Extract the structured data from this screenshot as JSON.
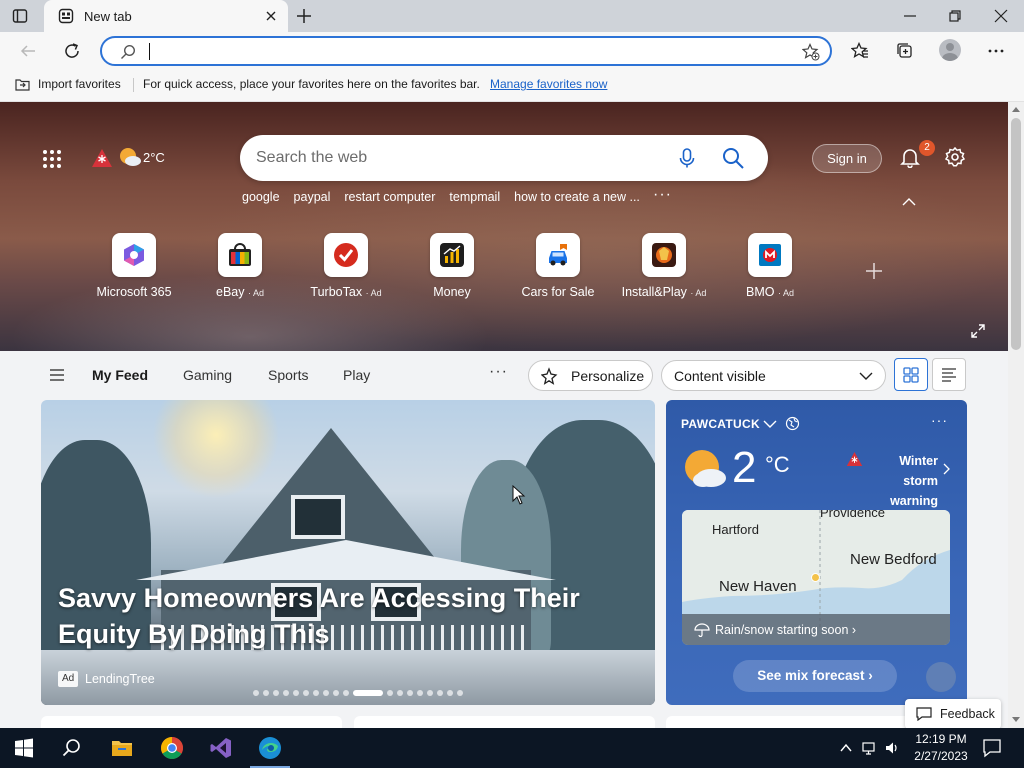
{
  "browser": {
    "tab_title": "New tab",
    "address_placeholder": "",
    "favorites_bar": {
      "import_label": "Import favorites",
      "message": "For quick access, place your favorites here on the favorites bar.",
      "link": "Manage favorites now"
    }
  },
  "header": {
    "weather_temp": "2°C",
    "search_placeholder": "Search the web",
    "sign_in": "Sign in",
    "notification_count": "2",
    "suggestions": [
      "google",
      "paypal",
      "restart computer",
      "tempmail",
      "how to create a new ..."
    ]
  },
  "quick_links": [
    {
      "label": "Microsoft 365",
      "ad": ""
    },
    {
      "label": "eBay",
      "ad": "· Ad"
    },
    {
      "label": "TurboTax",
      "ad": "· Ad"
    },
    {
      "label": "Money",
      "ad": ""
    },
    {
      "label": "Cars for Sale",
      "ad": ""
    },
    {
      "label": "Install&Play",
      "ad": "· Ad"
    },
    {
      "label": "BMO",
      "ad": "· Ad"
    }
  ],
  "feed_nav": {
    "tabs": [
      "My Feed",
      "Gaming",
      "Sports",
      "Play"
    ],
    "more": "···",
    "personalize": "Personalize",
    "content_visibility": "Content visible"
  },
  "hero_article": {
    "headline": "Savvy Homeowners Are Accessing Their Equity By Doing This",
    "ad_label": "Ad",
    "sponsor": "LendingTree",
    "slide_count": 19,
    "active_slide": 10
  },
  "weather": {
    "location": "PAWCATUCK",
    "temperature": "2",
    "unit": "°C",
    "alert": "Winter storm warning",
    "map_labels": [
      "Hartford",
      "Providence",
      "New Bedford",
      "New Haven"
    ],
    "map_banner": "Rain/snow starting soon ›",
    "forecast_button": "See mix forecast ›"
  },
  "feedback": "Feedback",
  "taskbar": {
    "time": "12:19 PM",
    "date": "2/27/2023"
  },
  "colors": {
    "accent": "#2d73d6",
    "weather_card": "#3a67b8",
    "badge": "#e0562b",
    "taskbar": "#0c1624"
  }
}
